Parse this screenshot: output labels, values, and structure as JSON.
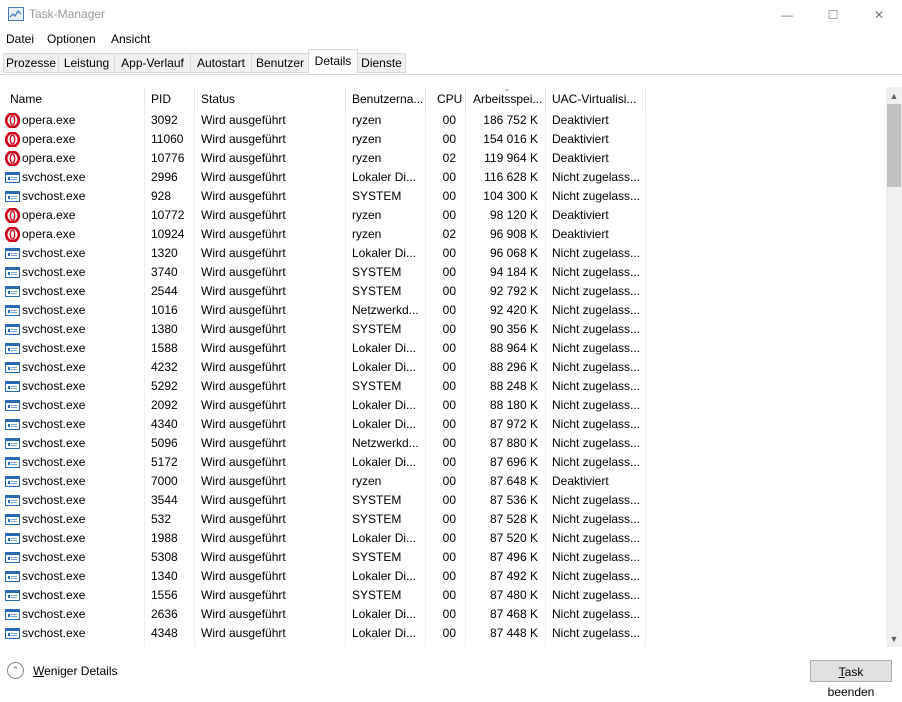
{
  "window": {
    "title": "Task-Manager",
    "min_glyph": "—",
    "max_glyph": "☐",
    "close_glyph": "✕"
  },
  "menu": [
    "Datei",
    "Optionen",
    "Ansicht"
  ],
  "tabs": [
    "Prozesse",
    "Leistung",
    "App-Verlauf",
    "Autostart",
    "Benutzer",
    "Details",
    "Dienste"
  ],
  "active_tab": "Details",
  "columns": [
    "Name",
    "PID",
    "Status",
    "Benutzerna...",
    "CPU",
    "Arbeitsspei...",
    "UAC-Virtualisi..."
  ],
  "sorted_column": "Arbeitsspei...",
  "sort_glyph": "⌄",
  "icons": {
    "opera": "opera-icon",
    "svchost": "svchost-icon",
    "app": "taskmanager-icon",
    "fewer": "chevron-up-circle-icon",
    "scroll_up": "▲",
    "scroll_down": "▼",
    "fewer_glyph": "⌃"
  },
  "colors": {
    "opera_red": "#d2001c",
    "svchost_blue": "#2a6ab5",
    "scrollbar_thumb": "#c1c1c1"
  },
  "processes": [
    {
      "name": "opera.exe",
      "type": "opera",
      "pid": "3092",
      "status": "Wird ausgeführt",
      "user": "ryzen",
      "cpu": "00",
      "mem": "186 752 K",
      "uac": "Deaktiviert"
    },
    {
      "name": "opera.exe",
      "type": "opera",
      "pid": "11060",
      "status": "Wird ausgeführt",
      "user": "ryzen",
      "cpu": "00",
      "mem": "154 016 K",
      "uac": "Deaktiviert"
    },
    {
      "name": "opera.exe",
      "type": "opera",
      "pid": "10776",
      "status": "Wird ausgeführt",
      "user": "ryzen",
      "cpu": "02",
      "mem": "119 964 K",
      "uac": "Deaktiviert"
    },
    {
      "name": "svchost.exe",
      "type": "svchost",
      "pid": "2996",
      "status": "Wird ausgeführt",
      "user": "Lokaler Di...",
      "cpu": "00",
      "mem": "116 628 K",
      "uac": "Nicht zugelass..."
    },
    {
      "name": "svchost.exe",
      "type": "svchost",
      "pid": "928",
      "status": "Wird ausgeführt",
      "user": "SYSTEM",
      "cpu": "00",
      "mem": "104 300 K",
      "uac": "Nicht zugelass..."
    },
    {
      "name": "opera.exe",
      "type": "opera",
      "pid": "10772",
      "status": "Wird ausgeführt",
      "user": "ryzen",
      "cpu": "00",
      "mem": "98 120 K",
      "uac": "Deaktiviert"
    },
    {
      "name": "opera.exe",
      "type": "opera",
      "pid": "10924",
      "status": "Wird ausgeführt",
      "user": "ryzen",
      "cpu": "02",
      "mem": "96 908 K",
      "uac": "Deaktiviert"
    },
    {
      "name": "svchost.exe",
      "type": "svchost",
      "pid": "1320",
      "status": "Wird ausgeführt",
      "user": "Lokaler Di...",
      "cpu": "00",
      "mem": "96 068 K",
      "uac": "Nicht zugelass..."
    },
    {
      "name": "svchost.exe",
      "type": "svchost",
      "pid": "3740",
      "status": "Wird ausgeführt",
      "user": "SYSTEM",
      "cpu": "00",
      "mem": "94 184 K",
      "uac": "Nicht zugelass..."
    },
    {
      "name": "svchost.exe",
      "type": "svchost",
      "pid": "2544",
      "status": "Wird ausgeführt",
      "user": "SYSTEM",
      "cpu": "00",
      "mem": "92 792 K",
      "uac": "Nicht zugelass..."
    },
    {
      "name": "svchost.exe",
      "type": "svchost",
      "pid": "1016",
      "status": "Wird ausgeführt",
      "user": "Netzwerkd...",
      "cpu": "00",
      "mem": "92 420 K",
      "uac": "Nicht zugelass..."
    },
    {
      "name": "svchost.exe",
      "type": "svchost",
      "pid": "1380",
      "status": "Wird ausgeführt",
      "user": "SYSTEM",
      "cpu": "00",
      "mem": "90 356 K",
      "uac": "Nicht zugelass..."
    },
    {
      "name": "svchost.exe",
      "type": "svchost",
      "pid": "1588",
      "status": "Wird ausgeführt",
      "user": "Lokaler Di...",
      "cpu": "00",
      "mem": "88 964 K",
      "uac": "Nicht zugelass..."
    },
    {
      "name": "svchost.exe",
      "type": "svchost",
      "pid": "4232",
      "status": "Wird ausgeführt",
      "user": "Lokaler Di...",
      "cpu": "00",
      "mem": "88 296 K",
      "uac": "Nicht zugelass..."
    },
    {
      "name": "svchost.exe",
      "type": "svchost",
      "pid": "5292",
      "status": "Wird ausgeführt",
      "user": "SYSTEM",
      "cpu": "00",
      "mem": "88 248 K",
      "uac": "Nicht zugelass..."
    },
    {
      "name": "svchost.exe",
      "type": "svchost",
      "pid": "2092",
      "status": "Wird ausgeführt",
      "user": "Lokaler Di...",
      "cpu": "00",
      "mem": "88 180 K",
      "uac": "Nicht zugelass..."
    },
    {
      "name": "svchost.exe",
      "type": "svchost",
      "pid": "4340",
      "status": "Wird ausgeführt",
      "user": "Lokaler Di...",
      "cpu": "00",
      "mem": "87 972 K",
      "uac": "Nicht zugelass..."
    },
    {
      "name": "svchost.exe",
      "type": "svchost",
      "pid": "5096",
      "status": "Wird ausgeführt",
      "user": "Netzwerkd...",
      "cpu": "00",
      "mem": "87 880 K",
      "uac": "Nicht zugelass..."
    },
    {
      "name": "svchost.exe",
      "type": "svchost",
      "pid": "5172",
      "status": "Wird ausgeführt",
      "user": "Lokaler Di...",
      "cpu": "00",
      "mem": "87 696 K",
      "uac": "Nicht zugelass..."
    },
    {
      "name": "svchost.exe",
      "type": "svchost",
      "pid": "7000",
      "status": "Wird ausgeführt",
      "user": "ryzen",
      "cpu": "00",
      "mem": "87 648 K",
      "uac": "Deaktiviert"
    },
    {
      "name": "svchost.exe",
      "type": "svchost",
      "pid": "3544",
      "status": "Wird ausgeführt",
      "user": "SYSTEM",
      "cpu": "00",
      "mem": "87 536 K",
      "uac": "Nicht zugelass..."
    },
    {
      "name": "svchost.exe",
      "type": "svchost",
      "pid": "532",
      "status": "Wird ausgeführt",
      "user": "SYSTEM",
      "cpu": "00",
      "mem": "87 528 K",
      "uac": "Nicht zugelass..."
    },
    {
      "name": "svchost.exe",
      "type": "svchost",
      "pid": "1988",
      "status": "Wird ausgeführt",
      "user": "Lokaler Di...",
      "cpu": "00",
      "mem": "87 520 K",
      "uac": "Nicht zugelass..."
    },
    {
      "name": "svchost.exe",
      "type": "svchost",
      "pid": "5308",
      "status": "Wird ausgeführt",
      "user": "SYSTEM",
      "cpu": "00",
      "mem": "87 496 K",
      "uac": "Nicht zugelass..."
    },
    {
      "name": "svchost.exe",
      "type": "svchost",
      "pid": "1340",
      "status": "Wird ausgeführt",
      "user": "Lokaler Di...",
      "cpu": "00",
      "mem": "87 492 K",
      "uac": "Nicht zugelass..."
    },
    {
      "name": "svchost.exe",
      "type": "svchost",
      "pid": "1556",
      "status": "Wird ausgeführt",
      "user": "SYSTEM",
      "cpu": "00",
      "mem": "87 480 K",
      "uac": "Nicht zugelass..."
    },
    {
      "name": "svchost.exe",
      "type": "svchost",
      "pid": "2636",
      "status": "Wird ausgeführt",
      "user": "Lokaler Di...",
      "cpu": "00",
      "mem": "87 468 K",
      "uac": "Nicht zugelass..."
    },
    {
      "name": "svchost.exe",
      "type": "svchost",
      "pid": "4348",
      "status": "Wird ausgeführt",
      "user": "Lokaler Di...",
      "cpu": "00",
      "mem": "87 448 K",
      "uac": "Nicht zugelass..."
    }
  ],
  "footer": {
    "fewer_details": "Weniger Details",
    "end_task": "Task beenden"
  }
}
